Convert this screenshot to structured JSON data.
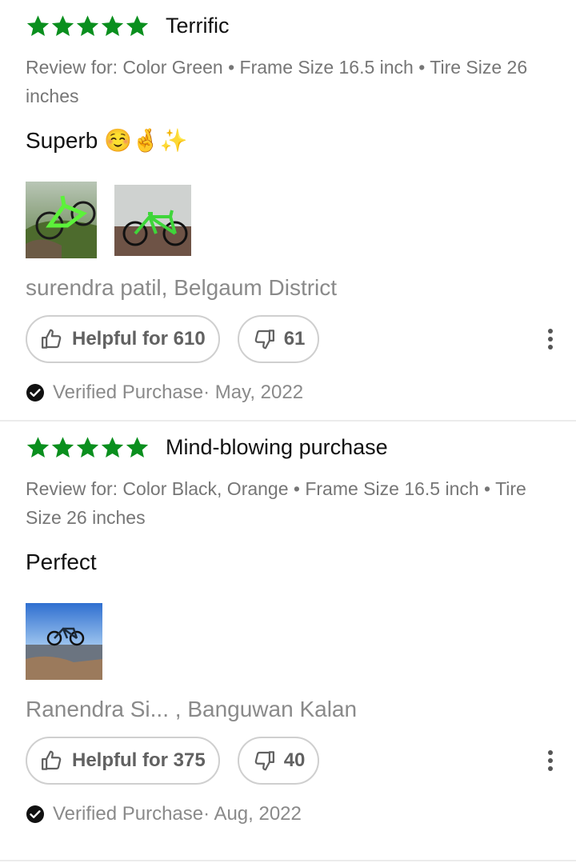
{
  "colors": {
    "star": "#0a8f1e",
    "muted": "#767676",
    "accent": "#212121"
  },
  "reviews": [
    {
      "stars": 5,
      "title": "Terrific",
      "variant": "Review for: Color Green • Frame Size 16.5 inch • Tire Size 26 inches",
      "body": "Superb ☺️🤞✨",
      "author": "surendra patil, Belgaum District",
      "helpful_label": "Helpful for 610",
      "dislike_count": "61",
      "verified": "Verified Purchase· May, 2022"
    },
    {
      "stars": 5,
      "title": "Mind-blowing purchase",
      "variant": "Review for: Color Black, Orange • Frame Size 16.5 inch • Tire Size 26 inches",
      "body": "Perfect",
      "author": "Ranendra Si...  , Banguwan Kalan",
      "helpful_label": "Helpful for 375",
      "dislike_count": "40",
      "verified": "Verified Purchase· Aug, 2022"
    }
  ]
}
